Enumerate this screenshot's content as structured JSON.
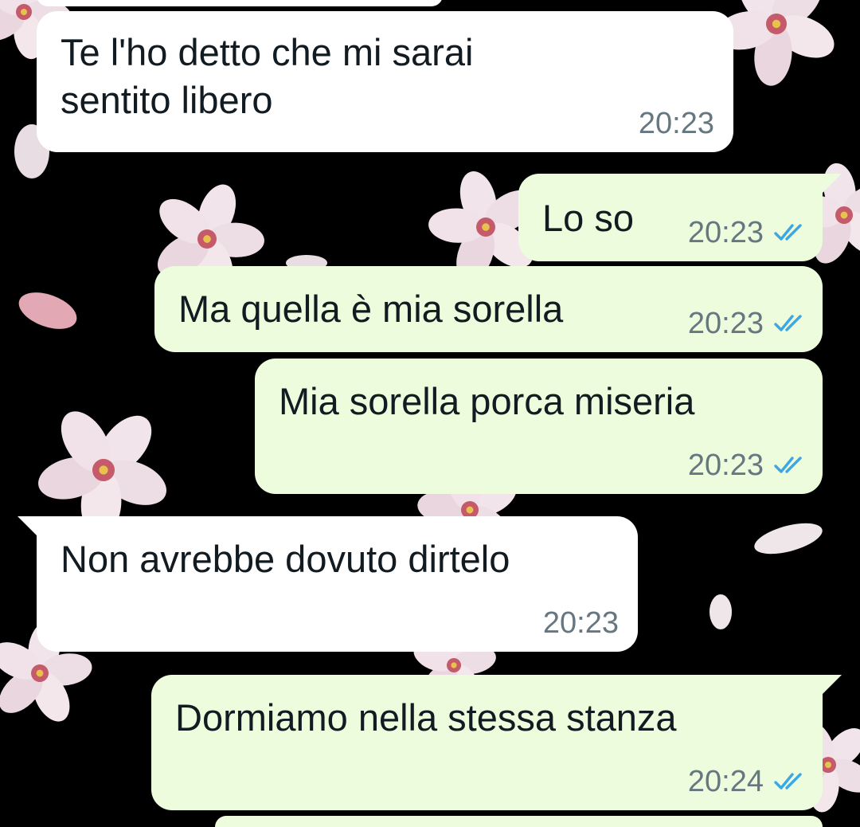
{
  "theme": {
    "incoming_bubble": "#ffffff",
    "outgoing_bubble": "#ecfcdc",
    "time_color": "#667781",
    "read_receipt_color": "#3ba7e6",
    "wallpaper": "black with pink cherry-blossom flowers"
  },
  "messages": [
    {
      "direction": "incoming",
      "text": "Te l'ho detto che mi sarai\nsentito libero",
      "time": "20:23"
    },
    {
      "direction": "outgoing",
      "text": "Lo so",
      "time": "20:23",
      "status": "read"
    },
    {
      "direction": "outgoing",
      "text": "Ma quella è mia sorella",
      "time": "20:23",
      "status": "read"
    },
    {
      "direction": "outgoing",
      "text": "Mia sorella porca miseria",
      "time": "20:23",
      "status": "read"
    },
    {
      "direction": "incoming",
      "text": "Non avrebbe dovuto dirtelo",
      "time": "20:23"
    },
    {
      "direction": "outgoing",
      "text": "Dormiamo nella stessa stanza",
      "time": "20:24",
      "status": "read"
    }
  ]
}
